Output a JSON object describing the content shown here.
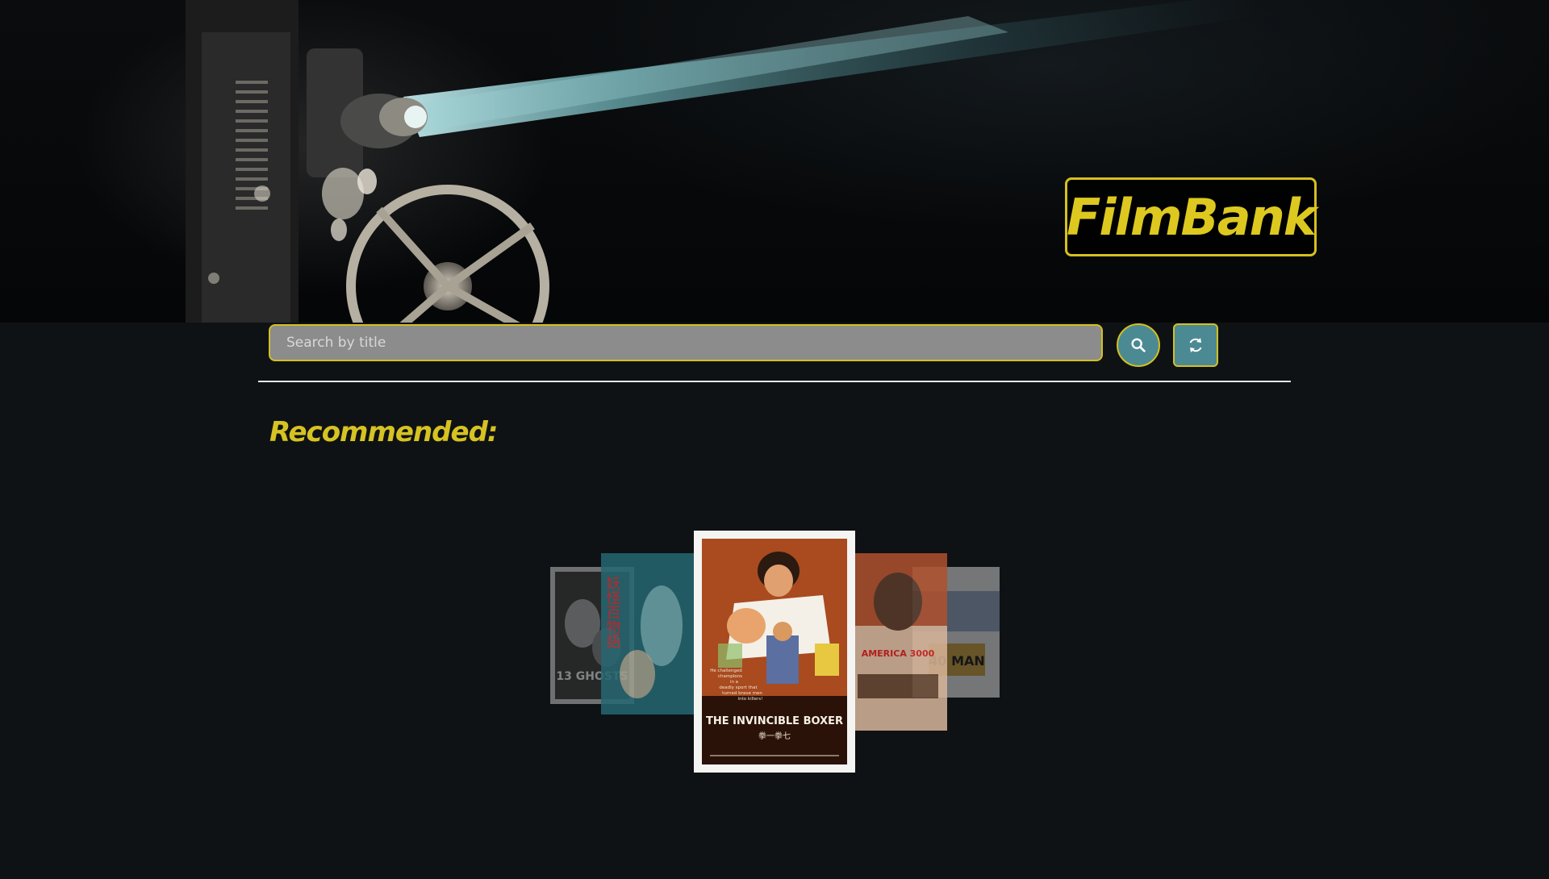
{
  "header": {
    "brand": "FilmBank",
    "brand_color": "#ddc820"
  },
  "search": {
    "placeholder": "Search by title",
    "value": "",
    "search_icon": "search-icon",
    "refresh_icon": "refresh-icon"
  },
  "recommended": {
    "title": "Recommended:",
    "posters": [
      {
        "title_text": "13 GHOSTS"
      },
      {
        "title_text": "妖怪百物語"
      },
      {
        "title_text": "THE INVINCIBLE BOXER",
        "tagline": [
          "He challenged",
          "champions",
          "in a",
          "deadly sport that",
          "turned brave men",
          "into killers!"
        ],
        "subtitle": "拳一拳七"
      },
      {
        "title_text": "AMERICA 3000"
      },
      {
        "title_text": "40 MAN"
      }
    ]
  },
  "colors": {
    "accent": "#d4c01e",
    "button": "#4b8a93",
    "background": "#0e1214",
    "input": "#8c8c8c"
  }
}
